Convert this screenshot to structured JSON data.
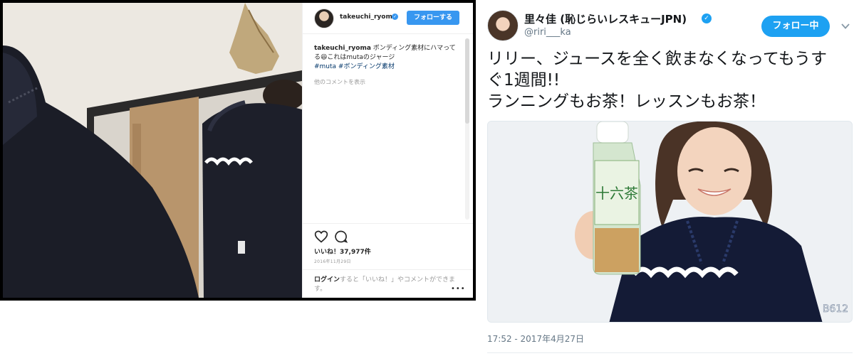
{
  "instagram": {
    "username": "takeuchi_ryoma",
    "follow_label": "フォローする",
    "caption_user": "takeuchi_ryoma",
    "caption_text": " ボンディング素材にハマってる😆これはmutaのジャージ",
    "caption_tags": "#muta #ボンディング素材",
    "more_comments": "他のコメントを表示",
    "likes": "いいね！37,977件",
    "date": "2016年11月29日",
    "login_link": "ログイン",
    "login_text": "すると「いいね！」やコメントができます。",
    "icons": [
      "heart-icon",
      "comment-icon",
      "more-dots-icon",
      "verified-badge-icon"
    ],
    "accent_color": "#3897f0"
  },
  "twitter": {
    "display_name": "里々佳 (恥じらいレスキューJPN)",
    "handle": "@riri___ka",
    "follow_label": "フォロー中",
    "tweet_text": "リリー、ジュースを全く飲まなくなってもうすぐ1週間!!\nランニングもお茶！レッスンもお茶！",
    "timestamp": "17:52 - 2017年4月27日",
    "photo_bottle_label": "十六茶",
    "photo_stamp": "B612",
    "icons": [
      "verified-badge-icon",
      "chevron-down-icon"
    ],
    "accent_color": "#1da1f2"
  }
}
